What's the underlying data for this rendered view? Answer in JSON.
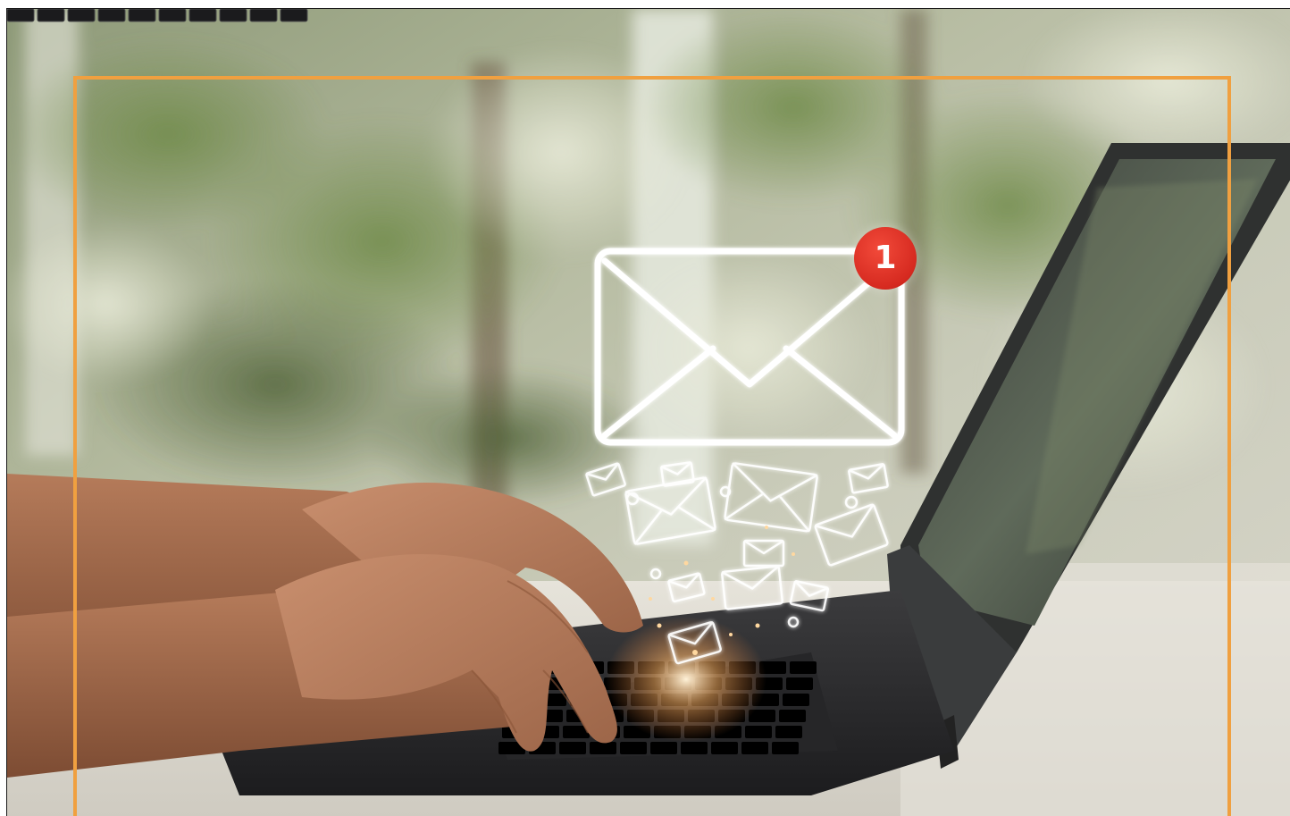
{
  "notification": {
    "badge_count": "1"
  },
  "icons": {
    "main": "envelope-icon",
    "floating": "envelope-icon"
  },
  "colors": {
    "frame_accent": "#f0a040",
    "badge": "#d62a20",
    "icon_stroke": "#ffffff"
  }
}
